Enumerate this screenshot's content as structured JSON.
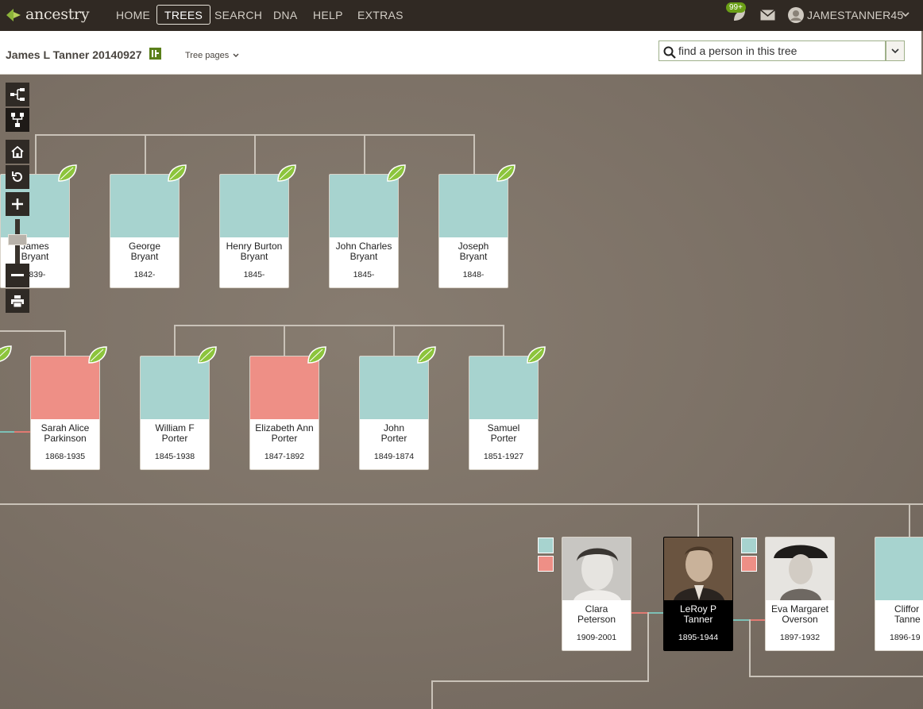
{
  "header": {
    "logo_text": "ancestry",
    "nav": [
      "HOME",
      "TREES",
      "SEARCH",
      "DNA",
      "HELP",
      "EXTRAS"
    ],
    "active_nav": "TREES",
    "notifications_badge": "99+",
    "username": "JAMESTANNER45"
  },
  "subheader": {
    "tree_title": "James L Tanner 20140927",
    "tree_pages_label": "Tree pages",
    "search_placeholder": "find a person in this tree"
  },
  "people": {
    "row1": [
      {
        "name_l1": "James",
        "name_l2": "Bryant",
        "dates": "1839-",
        "gender": "male"
      },
      {
        "name_l1": "George",
        "name_l2": "Bryant",
        "dates": "1842-",
        "gender": "male"
      },
      {
        "name_l1": "Henry Burton",
        "name_l2": "Bryant",
        "dates": "1845-",
        "gender": "male"
      },
      {
        "name_l1": "John Charles",
        "name_l2": "Bryant",
        "dates": "1845-",
        "gender": "male"
      },
      {
        "name_l1": "Joseph",
        "name_l2": "Bryant",
        "dates": "1848-",
        "gender": "male"
      }
    ],
    "row2": [
      {
        "name_l1": "Sarah Alice",
        "name_l2": "Parkinson",
        "dates": "1868-1935",
        "gender": "female"
      },
      {
        "name_l1": "William F",
        "name_l2": "Porter",
        "dates": "1845-1938",
        "gender": "male"
      },
      {
        "name_l1": "Elizabeth Ann",
        "name_l2": "Porter",
        "dates": "1847-1892",
        "gender": "female"
      },
      {
        "name_l1": "John",
        "name_l2": "Porter",
        "dates": "1849-1874",
        "gender": "male"
      },
      {
        "name_l1": "Samuel",
        "name_l2": "Porter",
        "dates": "1851-1927",
        "gender": "male"
      }
    ],
    "row3": [
      {
        "name_l1": "Clara",
        "name_l2": "Peterson",
        "dates": "1909-2001",
        "gender": "female"
      },
      {
        "name_l1": "LeRoy P",
        "name_l2": "Tanner",
        "dates": "1895-1944",
        "gender": "male"
      },
      {
        "name_l1": "Eva Margaret",
        "name_l2": "Overson",
        "dates": "1897-1932",
        "gender": "female"
      },
      {
        "name_l1": "Cliffor",
        "name_l2": "Tanne",
        "dates": "1896-19",
        "gender": "male"
      }
    ]
  },
  "colors": {
    "male": "#a7d3cf",
    "female": "#ee8f86",
    "nav_bg": "#302923",
    "badge": "#6b9f16"
  },
  "toolbar_icons": [
    "horizontal-tree-icon",
    "vertical-tree-icon",
    "home-icon",
    "refresh-icon",
    "zoom-in-icon",
    "zoom-out-icon",
    "print-icon"
  ]
}
